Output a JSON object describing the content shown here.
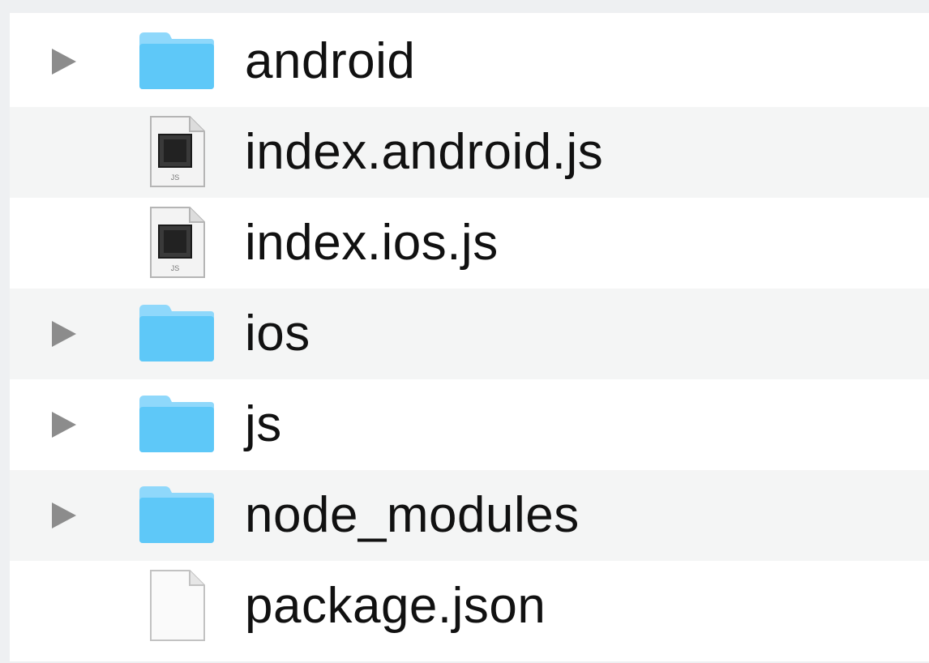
{
  "file_tree": {
    "items": [
      {
        "name": "android",
        "kind": "folder",
        "icon": "folder-icon"
      },
      {
        "name": "index.android.js",
        "kind": "file",
        "icon": "js-file-icon"
      },
      {
        "name": "index.ios.js",
        "kind": "file",
        "icon": "js-file-icon"
      },
      {
        "name": "ios",
        "kind": "folder",
        "icon": "folder-icon"
      },
      {
        "name": "js",
        "kind": "folder",
        "icon": "folder-icon"
      },
      {
        "name": "node_modules",
        "kind": "folder",
        "icon": "folder-icon"
      },
      {
        "name": "package.json",
        "kind": "file",
        "icon": "blank-file-icon"
      }
    ]
  },
  "colors": {
    "folder": "#5ec8f8",
    "folder_tab": "#8fd8fb",
    "arrow": "#8c8c8c",
    "row_alt": "#f4f5f5",
    "text": "#111111"
  }
}
